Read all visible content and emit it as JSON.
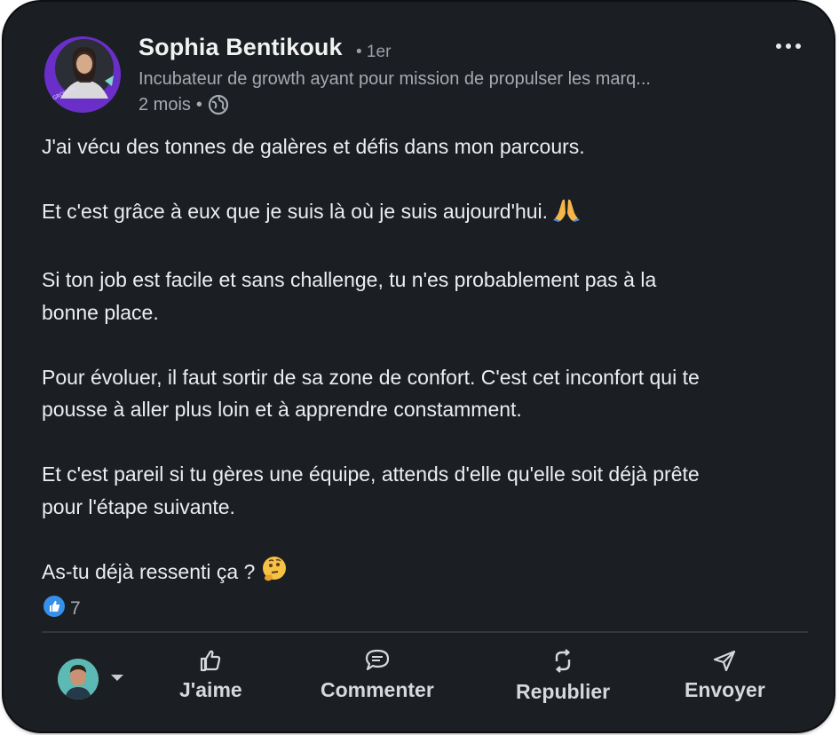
{
  "post": {
    "author": {
      "name": "Sophia Bentikouk",
      "degree": "• 1er",
      "headline": "Incubateur de growth ayant pour mission de propulser les marq...",
      "time": "2 mois",
      "separator": "•"
    },
    "paragraphs": [
      [
        "J'ai vécu des tonnes de galères et défis dans mon parcours."
      ],
      [
        "Et c'est grâce à eux que je suis là où je suis aujourd'hui. "
      ],
      [
        "Si ton job est facile et sans challenge, tu n'es probablement pas à la",
        "bonne place."
      ],
      [
        "Pour évoluer, il faut sortir de sa zone de confort. C'est cet inconfort qui te",
        "pousse à aller plus loin et à apprendre constamment."
      ],
      [
        "Et c'est pareil si tu gères une équipe, attends d'elle qu'elle soit déjà prête",
        "pour l'étape suivante."
      ],
      [
        "As-tu déjà ressenti ça ? "
      ]
    ],
    "emojis": [
      "praying-hands-emoji",
      "thinking-face-emoji"
    ],
    "reactions": {
      "count": "7",
      "icon": "like-reaction-icon"
    }
  },
  "actions": [
    {
      "label": "J'aime",
      "icon": "thumbs-up-icon"
    },
    {
      "label": "Commenter",
      "icon": "comment-icon"
    },
    {
      "label": "Republier",
      "icon": "repost-icon"
    },
    {
      "label": "Envoyer",
      "icon": "send-icon"
    }
  ],
  "colors": {
    "card_background": "#1b1e22",
    "text_primary": "#eceef0",
    "text_secondary": "#a6abb1",
    "avatar_ring": "#6a2ec9",
    "like_blue": "#378fe9"
  }
}
